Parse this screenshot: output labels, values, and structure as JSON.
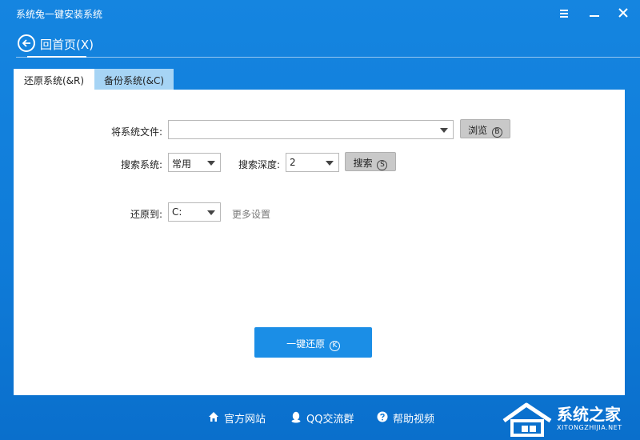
{
  "window": {
    "title": "系统兔一键安装系统"
  },
  "header": {
    "back_label": "回首页(X)"
  },
  "tabs": [
    {
      "label": "还原系统(&R)",
      "active": true
    },
    {
      "label": "备份系统(&C)",
      "active": false
    }
  ],
  "form": {
    "file_label": "将系统文件:",
    "file_value": "",
    "browse_label": "浏览",
    "browse_key": "B",
    "search_system_label": "搜索系统:",
    "search_system_value": "常用",
    "search_depth_label": "搜索深度:",
    "search_depth_value": "2",
    "search_label": "搜索",
    "search_key": "S",
    "restore_to_label": "还原到:",
    "restore_to_value": "C:",
    "more_settings": "更多设置"
  },
  "primary_action": {
    "label": "一键还原",
    "key": "K"
  },
  "footer": {
    "official_site": "官方网站",
    "qq_group": "QQ交流群",
    "help_video": "帮助视频"
  },
  "watermark": {
    "text": "系统之家",
    "sub": "XITONGZHIJIA.NET"
  },
  "colors": {
    "accent": "#1b8ee6",
    "background": "#0f7bd8",
    "tab_inactive": "#a6d4f5"
  }
}
